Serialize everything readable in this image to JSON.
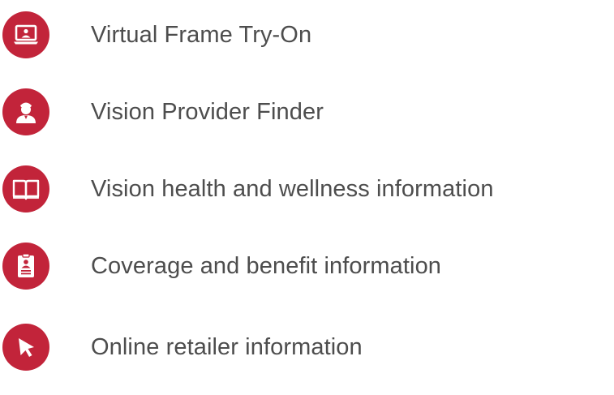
{
  "colors": {
    "accent": "#c2243a",
    "text": "#4d4d4d",
    "background": "#ffffff"
  },
  "features": [
    {
      "label": "Virtual Frame Try-On",
      "icon": "laptop-user-icon"
    },
    {
      "label": "Vision Provider Finder",
      "icon": "doctor-icon"
    },
    {
      "label": "Vision health and wellness information",
      "icon": "open-book-icon"
    },
    {
      "label": "Coverage and benefit information",
      "icon": "id-card-clipboard-icon"
    },
    {
      "label": "Online retailer information",
      "icon": "cursor-arrow-icon"
    }
  ]
}
